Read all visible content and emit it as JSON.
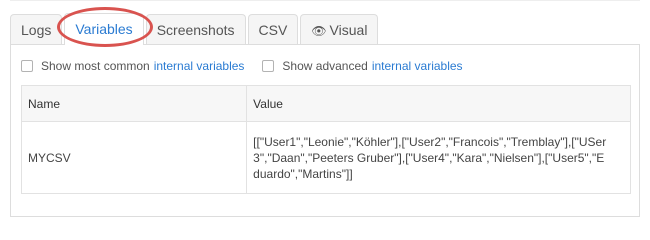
{
  "tabs": [
    {
      "label": "Logs",
      "active": false
    },
    {
      "label": "Variables",
      "active": true
    },
    {
      "label": "Screenshots",
      "active": false
    },
    {
      "label": "CSV",
      "active": false
    },
    {
      "label": "Visual",
      "icon": "eye-icon",
      "active": false
    }
  ],
  "options": {
    "common": {
      "prefix": "Show most common",
      "link": "internal variables"
    },
    "advanced": {
      "prefix": "Show advanced",
      "link": "internal variables"
    }
  },
  "table": {
    "headers": {
      "name": "Name",
      "value": "Value"
    },
    "rows": [
      {
        "name": "MYCSV",
        "value": "[[\"User1\",\"Leonie\",\"Köhler\"],[\"User2\",\"Francois\",\"Tremblay\"],[\"USer3\",\"Daan\",\"Peeters Gruber\"],[\"User4\",\"Kara\",\"Nielsen\"],[\"User5\",\"Eduardo\",\"Martins\"]]"
      }
    ]
  },
  "colors": {
    "accent": "#2a7bd2",
    "highlight": "#d9534f",
    "border": "#dddddd"
  }
}
